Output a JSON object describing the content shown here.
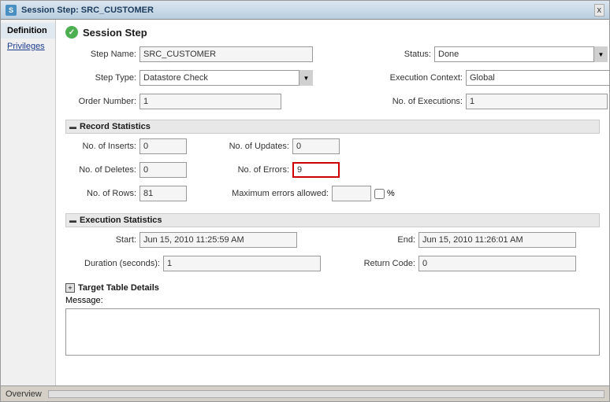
{
  "window": {
    "title": "Session Step: SRC_CUSTOMER",
    "close_label": "x"
  },
  "sidebar": {
    "items": [
      {
        "id": "definition",
        "label": "Definition",
        "active": true
      },
      {
        "id": "privileges",
        "label": "Privileges",
        "active": false
      }
    ]
  },
  "main": {
    "section_title": "Session Step",
    "section_icon": "✓",
    "fields": {
      "step_name_label": "Step Name:",
      "step_name_value": "SRC_CUSTOMER",
      "status_label": "Status:",
      "status_value": "Done",
      "step_type_label": "Step Type:",
      "step_type_value": "Datastore Check",
      "execution_context_label": "Execution Context:",
      "execution_context_value": "Global",
      "order_number_label": "Order Number:",
      "order_number_value": "1",
      "no_of_executions_label": "No. of Executions:",
      "no_of_executions_value": "1"
    },
    "record_statistics": {
      "title": "Record Statistics",
      "no_of_inserts_label": "No. of Inserts:",
      "no_of_inserts_value": "0",
      "no_of_updates_label": "No. of Updates:",
      "no_of_updates_value": "0",
      "no_of_deletes_label": "No. of Deletes:",
      "no_of_deletes_value": "0",
      "no_of_errors_label": "No. of Errors:",
      "no_of_errors_value": "9",
      "no_of_rows_label": "No. of Rows:",
      "no_of_rows_value": "81",
      "max_errors_label": "Maximum errors allowed:",
      "max_errors_value": "",
      "percent_label": "%"
    },
    "execution_statistics": {
      "title": "Execution Statistics",
      "start_label": "Start:",
      "start_value": "Jun 15, 2010 11:25:59 AM",
      "end_label": "End:",
      "end_value": "Jun 15, 2010 11:26:01 AM",
      "duration_label": "Duration (seconds):",
      "duration_value": "1",
      "return_code_label": "Return Code:",
      "return_code_value": "0"
    },
    "target_table": {
      "title": "Target Table Details",
      "message_label": "Message:"
    }
  },
  "status_bar": {
    "label": "Overview"
  }
}
